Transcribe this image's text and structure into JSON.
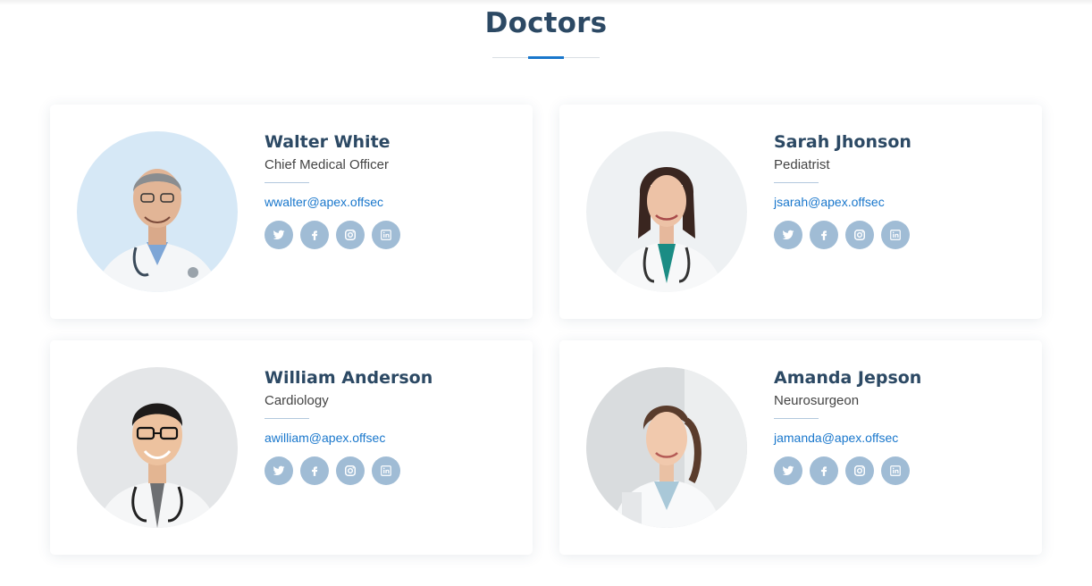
{
  "section": {
    "title": "Doctors"
  },
  "colors": {
    "title": "#2c4964",
    "accent": "#1977cc",
    "social_bg": "#a0bcd5"
  },
  "doctors": [
    {
      "name": "Walter White",
      "role": "Chief Medical Officer",
      "email": "wwalter@apex.offsec",
      "photo": "doctor-portrait-man-gray-hair",
      "socials": [
        "twitter-icon",
        "facebook-icon",
        "instagram-icon",
        "linkedin-icon"
      ]
    },
    {
      "name": "Sarah Jhonson",
      "role": "Pediatrist",
      "email": "jsarah@apex.offsec",
      "photo": "doctor-portrait-woman-dark-hair",
      "socials": [
        "twitter-icon",
        "facebook-icon",
        "instagram-icon",
        "linkedin-icon"
      ]
    },
    {
      "name": "William Anderson",
      "role": "Cardiology",
      "email": "awilliam@apex.offsec",
      "photo": "doctor-portrait-man-glasses",
      "socials": [
        "twitter-icon",
        "facebook-icon",
        "instagram-icon",
        "linkedin-icon"
      ]
    },
    {
      "name": "Amanda Jepson",
      "role": "Neurosurgeon",
      "email": "jamanda@apex.offsec",
      "photo": "doctor-portrait-woman-brown-hair",
      "socials": [
        "twitter-icon",
        "facebook-icon",
        "instagram-icon",
        "linkedin-icon"
      ]
    }
  ]
}
